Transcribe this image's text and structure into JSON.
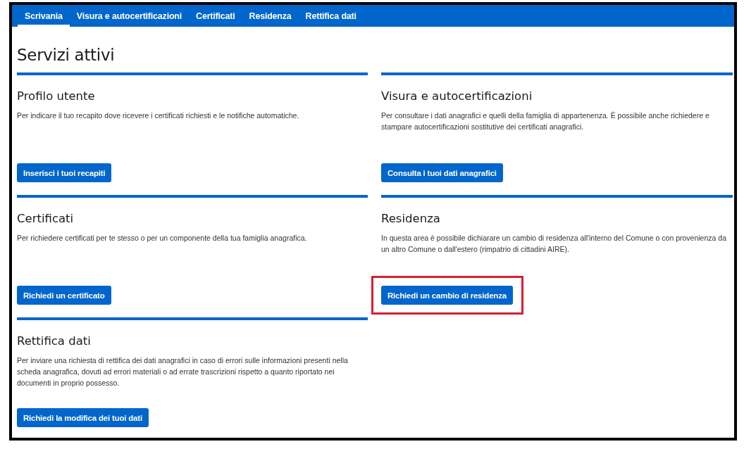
{
  "tabs": [
    {
      "label": "Scrivania",
      "selected": true
    },
    {
      "label": "Visura e autocertificazioni",
      "selected": false
    },
    {
      "label": "Certificati",
      "selected": false
    },
    {
      "label": "Residenza",
      "selected": false
    },
    {
      "label": "Rettifica dati",
      "selected": false
    }
  ],
  "page_title": "Servizi attivi",
  "cards": [
    {
      "title": "Profilo utente",
      "description": "Per indicare il tuo recapito dove ricevere i certificati richiesti e le notifiche automatiche.",
      "button": "Inserisci i tuoi recapiti",
      "highlighted": false
    },
    {
      "title": "Visura e autocertificazioni",
      "description": "Per consultare i dati anagrafici e quelli della famiglia di appartenenza. È possibile anche richiedere e stampare autocertificazioni sostitutive dei certificati anagrafici.",
      "button": "Consulta i tuoi dati anagrafici",
      "highlighted": false
    },
    {
      "title": "Certificati",
      "description": "Per richiedere certificati per te stesso o per un componente della tua famiglia anagrafica.",
      "button": "Richiedi un certificato",
      "highlighted": false
    },
    {
      "title": "Residenza",
      "description": "In questa area è possibile dichiarare un cambio di residenza all'interno del Comune o con provenienza da un altro Comune o dall'estero (rimpatrio di cittadini AIRE).",
      "button": "Richiedi un cambio di residenza",
      "highlighted": true
    },
    {
      "title": "Rettifica dati",
      "description": "Per inviare una richiesta di rettifica dei dati anagrafici in caso di errori sulle informazioni presenti nella scheda anagrafica, dovuti ad errori materiali o ad errate trascrizioni rispetto a quanto riportato nei documenti in proprio possesso.",
      "button": "Richiedi la modifica dei tuoi dati",
      "highlighted": false
    }
  ]
}
